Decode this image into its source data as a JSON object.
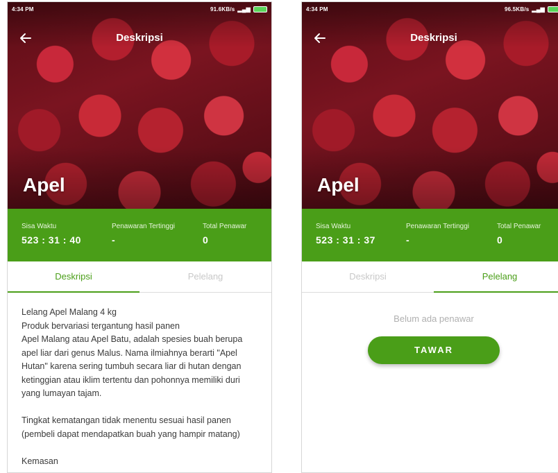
{
  "colors": {
    "primary": "#4a9e18",
    "tab_inactive": "#c8c8c8",
    "text": "#3a3a3a"
  },
  "screens": [
    {
      "status": {
        "time": "4:34 PM",
        "speed": "91.6KB/s"
      },
      "app_title": "Deskripsi",
      "product_name": "Apel",
      "info": {
        "time_label": "Sisa Waktu",
        "time_value": "523 : 31 : 40",
        "highest_label": "Penawaran Tertinggi",
        "highest_value": "-",
        "total_label": "Total Penawar",
        "total_value": "0"
      },
      "tabs": [
        "Deskripsi",
        "Pelelang"
      ],
      "active_tab": 0,
      "description": [
        "Lelang Apel Malang 4 kg",
        "Produk bervariasi tergantung hasil panen",
        "Apel Malang atau Apel Batu, adalah spesies buah berupa apel liar dari genus Malus. Nama ilmiahnya berarti \"Apel Hutan\" karena sering tumbuh secara liar di hutan dengan ketinggian atau iklim tertentu dan pohonnya memiliki duri yang lumayan tajam.",
        "",
        "Tingkat kematangan tidak menentu sesuai hasil panen (pembeli dapat mendapatkan buah yang hampir matang)",
        "",
        "Kemasan"
      ]
    },
    {
      "status": {
        "time": "4:34 PM",
        "speed": "96.5KB/s"
      },
      "app_title": "Deskripsi",
      "product_name": "Apel",
      "info": {
        "time_label": "Sisa Waktu",
        "time_value": "523 : 31 : 37",
        "highest_label": "Penawaran Tertinggi",
        "highest_value": "-",
        "total_label": "Total Penawar",
        "total_value": "0"
      },
      "tabs": [
        "Deskripsi",
        "Pelelang"
      ],
      "active_tab": 1,
      "empty_text": "Belum ada penawar",
      "bid_button": "TAWAR"
    }
  ]
}
